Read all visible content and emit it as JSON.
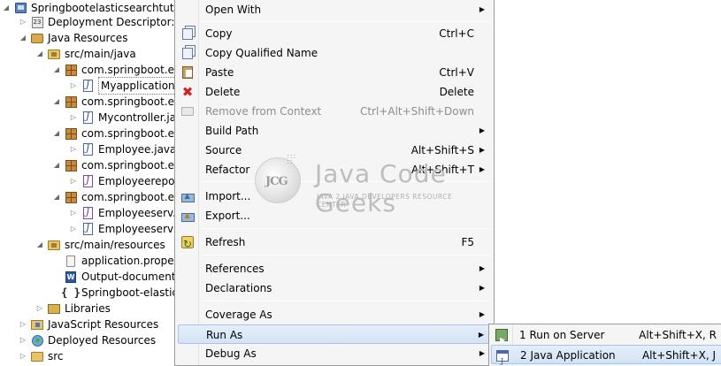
{
  "tree": {
    "items": [
      {
        "label": "Springbootelasticsearchtutorial",
        "icon": "project-icon",
        "twisty": "expanded"
      },
      {
        "label": "Deployment Descriptor: Ar",
        "icon": "deployment-descriptor-icon",
        "twisty": "collapsed"
      },
      {
        "label": "Java Resources",
        "icon": "java-resources-icon",
        "twisty": "expanded"
      },
      {
        "label": "src/main/java",
        "icon": "source-folder-icon",
        "twisty": "expanded"
      },
      {
        "label": "com.springboot.ela",
        "icon": "package-icon",
        "twisty": "expanded"
      },
      {
        "label": "Myapplication.ja",
        "icon": "java-file-icon",
        "twisty": "collapsed",
        "selected": true
      },
      {
        "label": "com.springboot.ela",
        "icon": "package-icon",
        "twisty": "expanded"
      },
      {
        "label": "Mycontroller.jav",
        "icon": "java-file-icon",
        "twisty": "collapsed"
      },
      {
        "label": "com.springboot.ela",
        "icon": "package-icon",
        "twisty": "expanded"
      },
      {
        "label": "Employee.java",
        "icon": "java-file-icon",
        "twisty": "collapsed"
      },
      {
        "label": "com.springboot.ela",
        "icon": "package-icon",
        "twisty": "expanded"
      },
      {
        "label": "Employeereposi",
        "icon": "interface-file-icon",
        "twisty": "collapsed"
      },
      {
        "label": "com.springboot.ela",
        "icon": "package-icon",
        "twisty": "expanded"
      },
      {
        "label": "Employeeserv.ja",
        "icon": "interface-file-icon",
        "twisty": "collapsed"
      },
      {
        "label": "Employeeservin",
        "icon": "java-file-icon",
        "twisty": "collapsed"
      },
      {
        "label": "src/main/resources",
        "icon": "source-folder-icon",
        "twisty": "expanded"
      },
      {
        "label": "application.propert",
        "icon": "properties-file-icon",
        "twisty": ""
      },
      {
        "label": "Output-documenta",
        "icon": "word-document-icon",
        "twisty": ""
      },
      {
        "label": "Springboot-elastics",
        "icon": "json-file-icon",
        "twisty": ""
      },
      {
        "label": "Libraries",
        "icon": "libraries-icon",
        "twisty": "collapsed"
      },
      {
        "label": "JavaScript Resources",
        "icon": "javascript-resources-icon",
        "twisty": "collapsed"
      },
      {
        "label": "Deployed Resources",
        "icon": "deployed-resources-icon",
        "twisty": "collapsed"
      },
      {
        "label": "src",
        "icon": "folder-icon",
        "twisty": "collapsed"
      }
    ]
  },
  "menu": {
    "open_with": "Open With",
    "copy": "Copy",
    "copy_shortcut": "Ctrl+C",
    "copy_qualified_name": "Copy Qualified Name",
    "paste": "Paste",
    "paste_shortcut": "Ctrl+V",
    "delete": "Delete",
    "delete_shortcut": "Delete",
    "remove_from_context": "Remove from Context",
    "remove_from_context_shortcut": "Ctrl+Alt+Shift+Down",
    "build_path": "Build Path",
    "source": "Source",
    "source_shortcut": "Alt+Shift+S",
    "refactor": "Refactor",
    "refactor_shortcut": "Alt+Shift+T",
    "import": "Import...",
    "export": "Export...",
    "refresh": "Refresh",
    "refresh_shortcut": "F5",
    "references": "References",
    "declarations": "Declarations",
    "coverage_as": "Coverage As",
    "run_as": "Run As",
    "debug_as": "Debug As",
    "submenu_arrow": "▶"
  },
  "submenu": {
    "run_on_server": "1 Run on Server",
    "run_on_server_shortcut": "Alt+Shift+X, R",
    "java_application": "2 Java Application",
    "java_application_shortcut": "Alt+Shift+X, J"
  },
  "watermark": {
    "logo_text": "JCG",
    "title": "Java Code Geeks",
    "subtitle": "JAVA 2 JAVA DEVELOPERS RESOURCE CENTER"
  },
  "colors": {
    "menu_background": "#f5f5f5",
    "hover_highlight": "#d3e3f6",
    "disabled_text": "#8d8d8d"
  }
}
